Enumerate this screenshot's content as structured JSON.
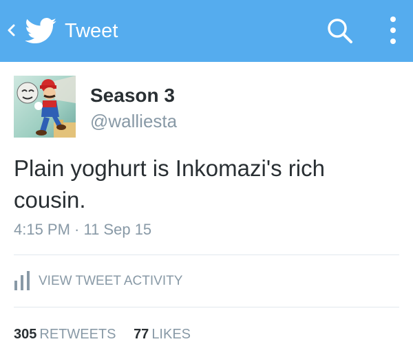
{
  "colors": {
    "brand": "#55acee",
    "text_primary": "#292f33",
    "text_secondary": "#8899a6",
    "divider": "#e1e8ed"
  },
  "header": {
    "title": "Tweet",
    "back_icon": "chevron-left-icon",
    "logo_icon": "twitter-bird-icon",
    "search_icon": "search-icon",
    "overflow_icon": "more-vertical-icon"
  },
  "tweet": {
    "author": {
      "display_name": "Season 3",
      "handle": "@walliesta",
      "avatar_icon": "avatar-illustration"
    },
    "text": "Plain yoghurt is Inkomazi's rich cousin.",
    "timestamp": "4:15 PM · 11 Sep 15"
  },
  "activity": {
    "label": "VIEW TWEET ACTIVITY",
    "icon": "bar-chart-icon"
  },
  "stats": {
    "retweets": {
      "count": "305",
      "label": "RETWEETS"
    },
    "likes": {
      "count": "77",
      "label": "LIKES"
    }
  }
}
